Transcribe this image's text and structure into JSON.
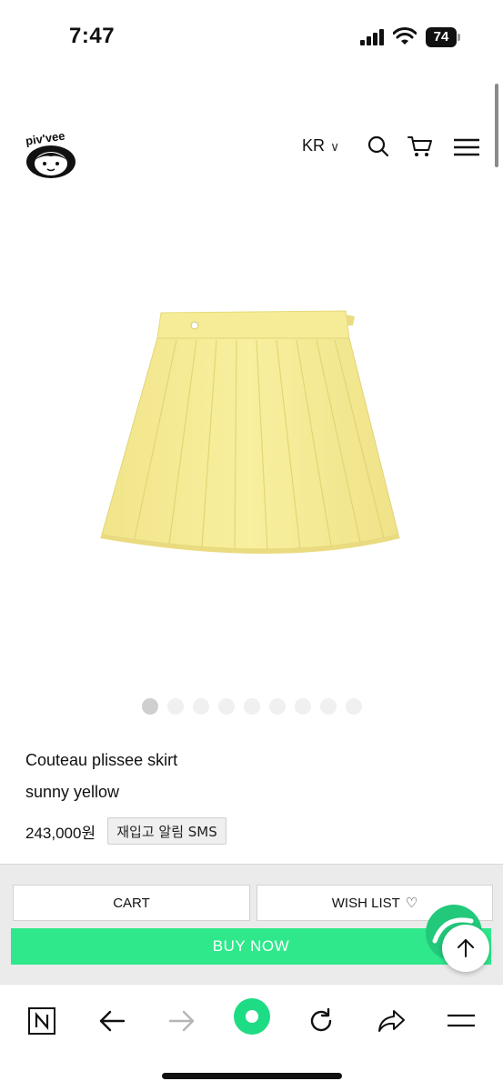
{
  "status_bar": {
    "time": "7:47",
    "battery": "74"
  },
  "header": {
    "logo_text": "piv'vee",
    "language": "KR",
    "icons": [
      "search-icon",
      "cart-icon",
      "menu-icon"
    ]
  },
  "product": {
    "image_alt": "yellow pleated skirt",
    "carousel_count": 9,
    "carousel_active": 1,
    "name": "Couteau plissee skirt",
    "color": "sunny yellow",
    "price": "243,000원",
    "restock_label": "재입고 알림 SMS"
  },
  "actions": {
    "cart_label": "CART",
    "wishlist_label": "WISH LIST",
    "wishlist_icon": "♡",
    "buy_label": "BUY NOW"
  },
  "colors": {
    "buy_green": "#2ee88b",
    "skirt_yellow": "#f6ec9a"
  },
  "browser_toolbar": {
    "icons": [
      "naver-icon",
      "back-icon",
      "forward-icon",
      "home-icon",
      "reload-icon",
      "share-icon",
      "menu-icon"
    ]
  }
}
